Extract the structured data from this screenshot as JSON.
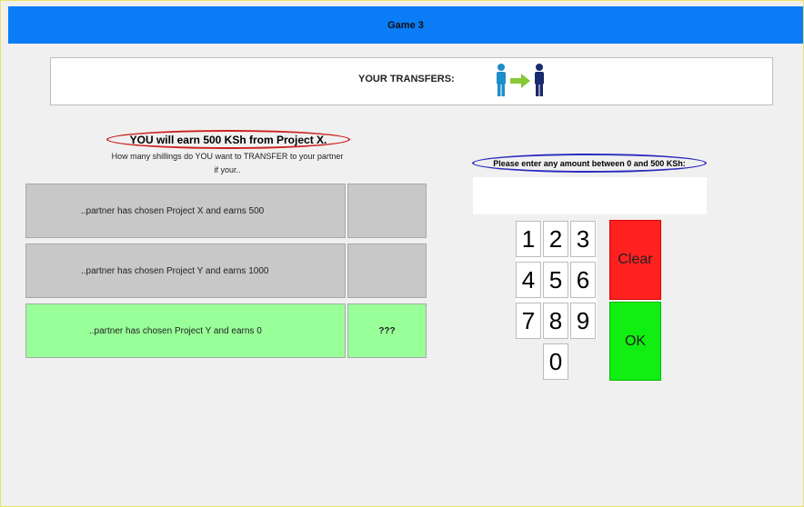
{
  "window": {
    "title": "Game 3"
  },
  "transfers": {
    "label": "YOUR TRANSFERS:",
    "icon": "person-arrow-person-icon"
  },
  "left": {
    "earn_text": "YOU will earn 500 KSh from Project X.",
    "question_line1": "How many shillings do YOU want to TRANSFER to your partner",
    "question_line2": "if your..",
    "rows": [
      {
        "label": "..partner has chosen Project X and earns 500",
        "value": "",
        "state": "done"
      },
      {
        "label": "..partner has chosen Project Y and earns 1000",
        "value": "",
        "state": "done"
      },
      {
        "label": "..partner has chosen Project Y and earns 0",
        "value": "???",
        "state": "active"
      }
    ]
  },
  "right": {
    "instruction": "Please enter any amount between 0 and 500 KSh:",
    "amount_value": "",
    "keys": [
      "1",
      "2",
      "3",
      "4",
      "5",
      "6",
      "7",
      "8",
      "9",
      "0"
    ],
    "clear_label": "Clear",
    "ok_label": "OK"
  },
  "colors": {
    "titlebar": "#0a7cf5",
    "earn_outline": "#cc2020",
    "instruction_outline": "#2b2bbf",
    "row_done": "#c8c8c8",
    "row_active": "#99ff99",
    "clear": "#ff2020",
    "ok": "#11ee11",
    "icon_person_left": "#1e8fc8",
    "icon_arrow": "#86c836",
    "icon_person_right": "#1a2a6e"
  }
}
